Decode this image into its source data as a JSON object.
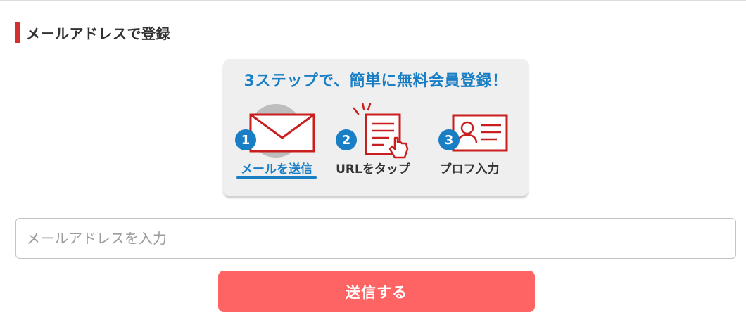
{
  "heading": "メールアドレスで登録",
  "steps_banner": {
    "title": "3ステップで、簡単に無料会員登録！",
    "steps": [
      {
        "number": "1",
        "label": "メールを送信",
        "icon": "envelope-icon",
        "active": true
      },
      {
        "number": "2",
        "label": "URLをタップ",
        "icon": "document-tap-icon",
        "active": false
      },
      {
        "number": "3",
        "label": "プロフ入力",
        "icon": "profile-card-icon",
        "active": false
      }
    ]
  },
  "email_input": {
    "placeholder": "メールアドレスを入力",
    "value": ""
  },
  "submit_button": {
    "label": "送信する"
  },
  "colors": {
    "accent_blue": "#1a7ec5",
    "accent_red": "#d32f2f",
    "button_red": "#ff6464",
    "card_bg": "#efefef"
  }
}
